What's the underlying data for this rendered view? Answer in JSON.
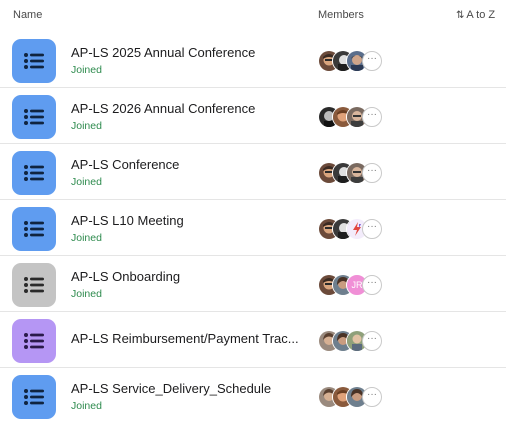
{
  "header": {
    "name_label": "Name",
    "members_label": "Members",
    "sort_label": "A to Z",
    "sort_icon": "sort-arrows-icon"
  },
  "colors": {
    "icon_blue": "#5f9cf0",
    "icon_gray": "#c4c4c4",
    "icon_purple": "#b596f4",
    "joined_green": "#2e8b4e"
  },
  "rows": [
    {
      "title": "AP-LS 2025 Annual Conference",
      "status": "Joined",
      "icon_color": "blue"
    },
    {
      "title": "AP-LS 2026 Annual Conference",
      "status": "Joined",
      "icon_color": "blue"
    },
    {
      "title": "AP-LS Conference",
      "status": "Joined",
      "icon_color": "blue"
    },
    {
      "title": "AP-LS L10 Meeting",
      "status": "Joined",
      "icon_color": "blue"
    },
    {
      "title": "AP-LS Onboarding",
      "status": "Joined",
      "icon_color": "gray",
      "member_initials": "JR"
    },
    {
      "title": "AP-LS Reimbursement/Payment Trac...",
      "status": "",
      "icon_color": "purple"
    },
    {
      "title": "AP-LS Service_Delivery_Schedule",
      "status": "Joined",
      "icon_color": "blue"
    }
  ],
  "more_label": "···"
}
